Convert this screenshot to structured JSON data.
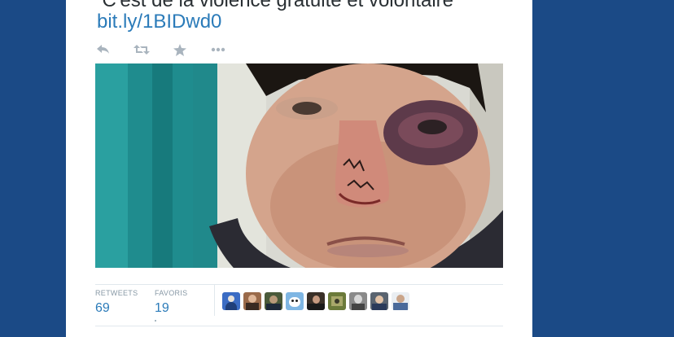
{
  "tweet": {
    "text": "\"C'est de la violence gratuite et volontaire\"",
    "link": "bit.ly/1BIDwd0"
  },
  "actions": [
    {
      "name": "reply-icon"
    },
    {
      "name": "retweet-icon"
    },
    {
      "name": "favorite-star-icon"
    },
    {
      "name": "more-options-icon"
    }
  ],
  "stats": {
    "retweets_label": "RETWEETS",
    "retweets_count": "69",
    "favorites_label": "FAVORIS",
    "favorites_count": "19"
  },
  "colors": {
    "page_background": "#1b4a86",
    "card_background": "#ffffff",
    "link": "#2b7bb9",
    "icon": "#a9b4be"
  },
  "avatars": [
    {
      "color": "#3b6cc4"
    },
    {
      "color": "#9a6a4a"
    },
    {
      "color": "#4a5a3a"
    },
    {
      "color": "#7fb6e3"
    },
    {
      "color": "#3a3028"
    },
    {
      "color": "#6b7a3a"
    },
    {
      "color": "#8a8a8a"
    },
    {
      "color": "#5a6470"
    },
    {
      "color": "#4a6a9a"
    }
  ]
}
